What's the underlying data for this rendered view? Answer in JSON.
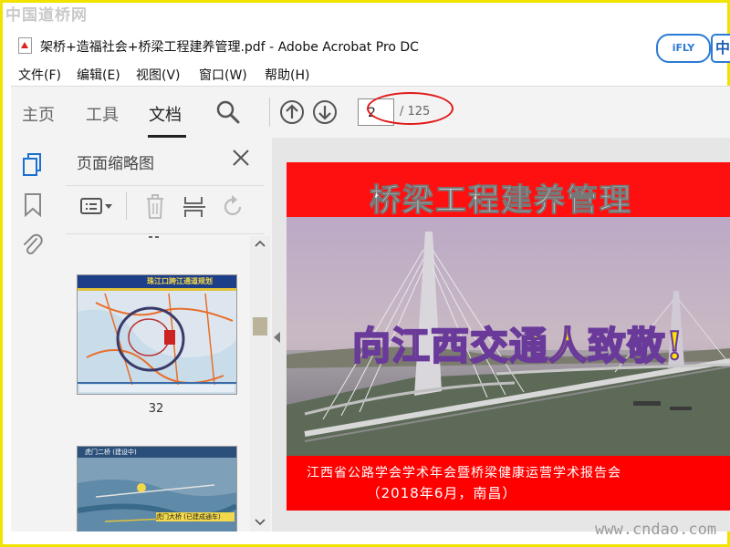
{
  "watermark_top": "中国道桥网",
  "watermark_bottom": "www.cndao.com",
  "window": {
    "title": "架桥+造福社会+桥梁工程建养管理.pdf - Adobe Acrobat Pro DC"
  },
  "ifly": {
    "badge": "iFLY",
    "lang": "中"
  },
  "menu": [
    "文件(F)",
    "编辑(E)",
    "视图(V)",
    "窗口(W)",
    "帮助(H)"
  ],
  "tabs": {
    "home": "主页",
    "tools": "工具",
    "document": "文档"
  },
  "navigation": {
    "current_page": "2",
    "total_pages": "/ 125"
  },
  "thumbnail_panel": {
    "title": "页面缩略图",
    "items": [
      {
        "page_label": "32",
        "heading": "珠江口跨江通道规划"
      },
      {
        "heading": "虎门二桥 (建设中)",
        "subtitle": "虎门大桥 (已建成通车)"
      }
    ]
  },
  "page_content": {
    "title": "桥梁工程建养管理",
    "slogan": "向江西交通人致敬!",
    "footer_line1": "江西省公路学会学术年会暨桥梁健康运营学术报告会",
    "footer_line2": "（2018年6月，南昌）"
  },
  "colors": {
    "accent_red": "#ff1010",
    "slogan_yellow": "#ffe000",
    "frame_yellow": "#f2e200",
    "annotation_red": "#e01818"
  }
}
